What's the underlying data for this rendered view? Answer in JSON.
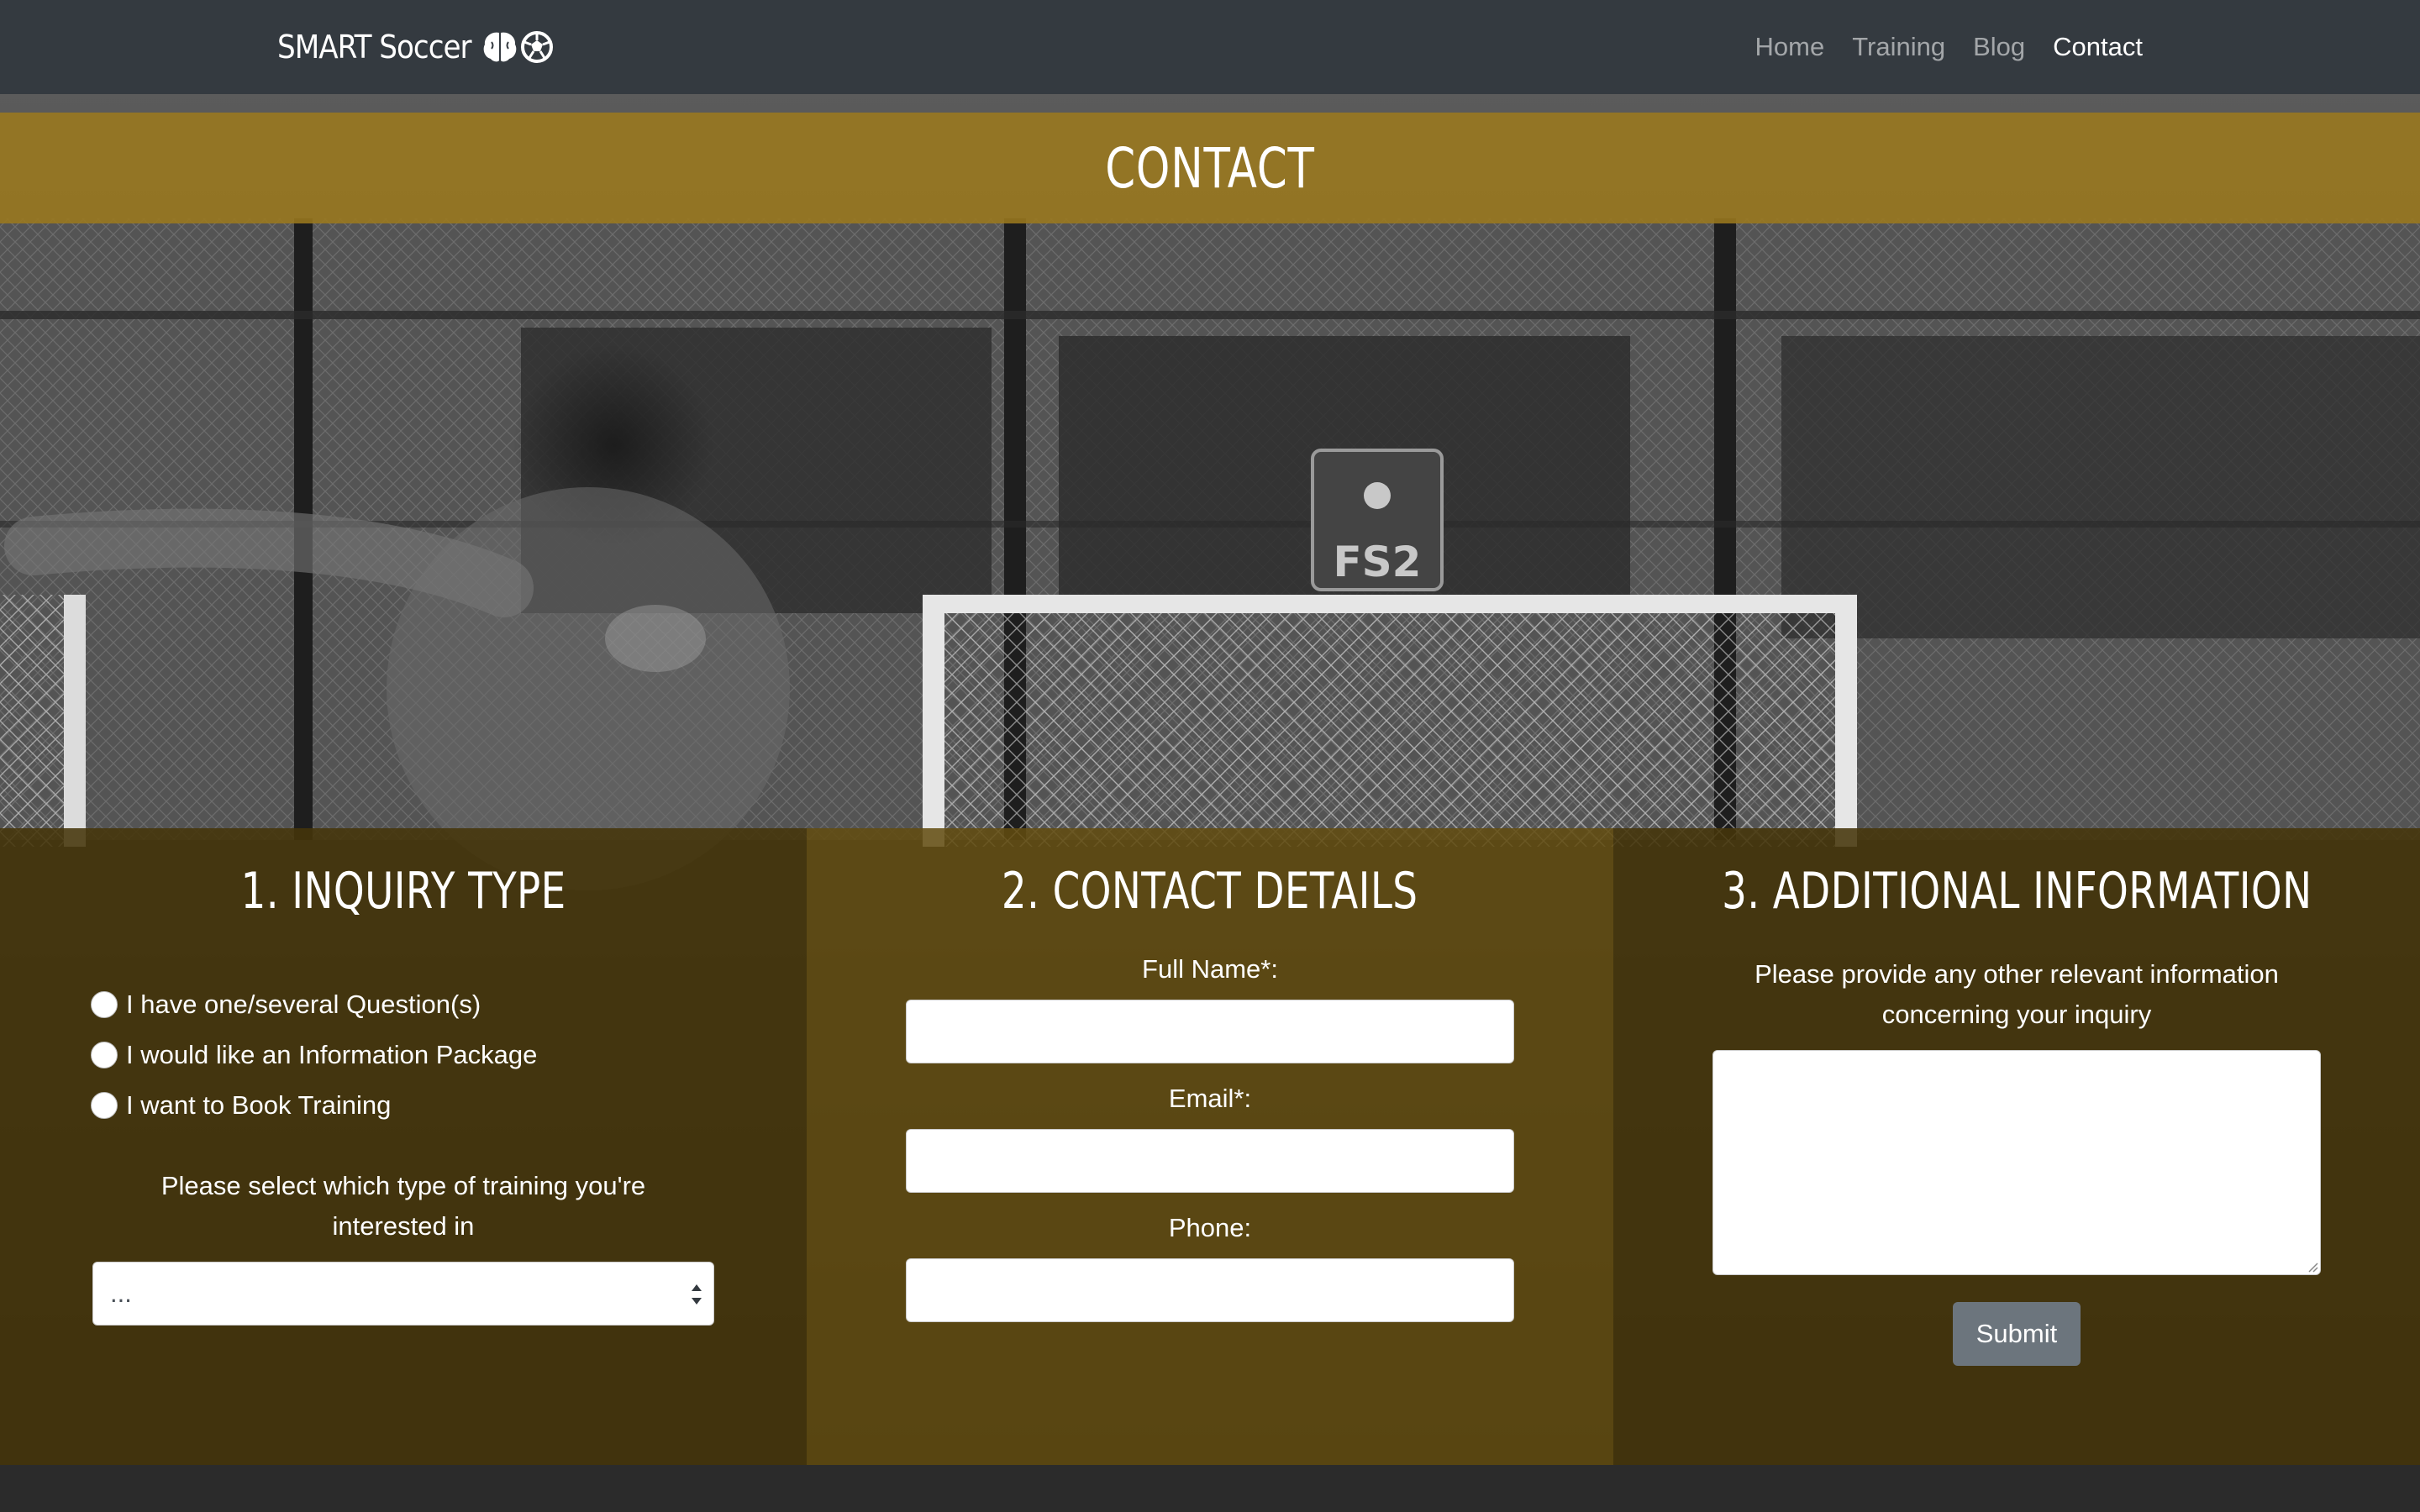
{
  "navbar": {
    "brand": "SMART Soccer",
    "links": [
      {
        "label": "Home",
        "active": false
      },
      {
        "label": "Training",
        "active": false
      },
      {
        "label": "Blog",
        "active": false
      },
      {
        "label": "Contact",
        "active": true
      }
    ]
  },
  "hero": {
    "title": "CONTACT",
    "sign_text": "FS2"
  },
  "form": {
    "inquiry": {
      "heading": "1. INQUIRY TYPE",
      "options": [
        "I have one/several Question(s)",
        "I would like an Information Package",
        "I want to Book Training"
      ],
      "training_help": "Please select which type of training you're interested in",
      "training_select_value": "..."
    },
    "contact": {
      "heading": "2. CONTACT DETAILS",
      "full_name_label": "Full Name*:",
      "email_label": "Email*:",
      "phone_label": "Phone:",
      "full_name_value": "",
      "email_value": "",
      "phone_value": ""
    },
    "additional": {
      "heading": "3. ADDITIONAL INFORMATION",
      "help": "Please provide any other relevant information concerning your inquiry",
      "value": "",
      "submit_label": "Submit"
    }
  },
  "colors": {
    "navbar": "#343a40",
    "banner": "#9b791e",
    "form_panel": "#46360a",
    "button": "#6c757d"
  }
}
